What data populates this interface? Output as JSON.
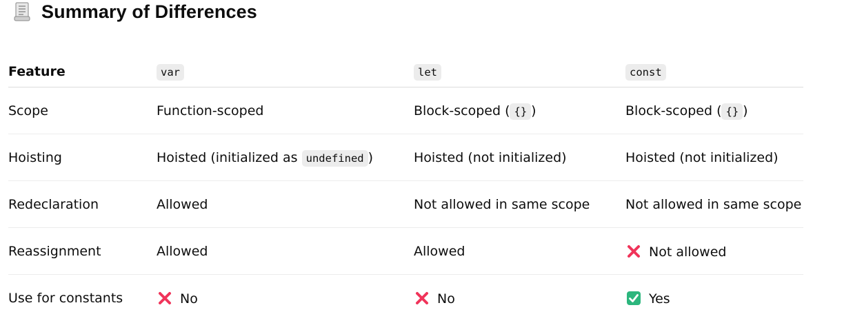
{
  "heading": {
    "icon": "receipt-icon",
    "title": "Summary of Differences"
  },
  "table": {
    "headers": {
      "feature": "Feature",
      "var": "var",
      "let": "let",
      "const": "const"
    },
    "rows": [
      {
        "feature": "Scope",
        "var": {
          "text": "Function-scoped"
        },
        "let": {
          "before": "Block-scoped (",
          "code": "{}",
          "after": ")"
        },
        "const": {
          "before": "Block-scoped (",
          "code": "{}",
          "after": ")"
        }
      },
      {
        "feature": "Hoisting",
        "var": {
          "before": "Hoisted (initialized as ",
          "code": "undefined",
          "after": ")"
        },
        "let": {
          "text": "Hoisted (not initialized)"
        },
        "const": {
          "text": "Hoisted (not initialized)"
        }
      },
      {
        "feature": "Redeclaration",
        "var": {
          "text": "Allowed"
        },
        "let": {
          "text": "Not allowed in same scope"
        },
        "const": {
          "text": "Not allowed in same scope"
        }
      },
      {
        "feature": "Reassignment",
        "var": {
          "text": "Allowed"
        },
        "let": {
          "text": "Allowed"
        },
        "const": {
          "icon": "cross-mark-icon",
          "text": "Not allowed"
        }
      },
      {
        "feature": "Use for constants",
        "var": {
          "icon": "cross-mark-icon",
          "text": "No"
        },
        "let": {
          "icon": "cross-mark-icon",
          "text": "No"
        },
        "const": {
          "icon": "check-mark-icon",
          "text": "Yes"
        }
      }
    ]
  },
  "colors": {
    "cross": "#f0345a",
    "check": "#2cb67d",
    "code_bg": "#ececec"
  }
}
